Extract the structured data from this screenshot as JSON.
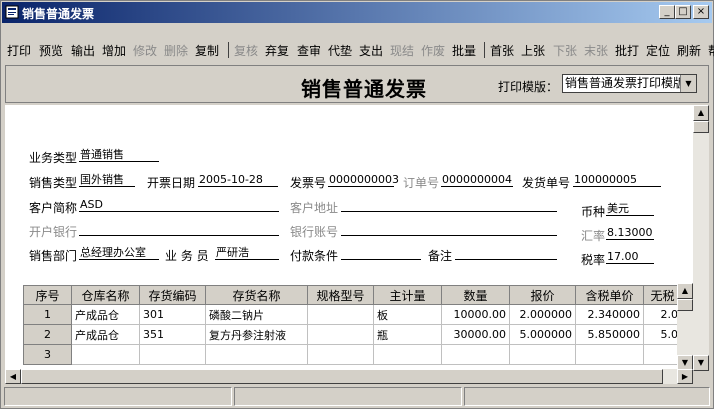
{
  "window": {
    "title": "销售普通发票",
    "controls": [
      "_",
      "□",
      "×"
    ]
  },
  "toolbar": [
    {
      "label": "打印",
      "enabled": true
    },
    {
      "label": "预览",
      "enabled": true
    },
    {
      "label": "输出",
      "enabled": true
    },
    {
      "label": "增加",
      "enabled": true
    },
    {
      "label": "修改",
      "enabled": false
    },
    {
      "label": "删除",
      "enabled": false
    },
    {
      "label": "复制",
      "enabled": true
    },
    {
      "label": "复核",
      "enabled": false
    },
    {
      "label": "弃复",
      "enabled": true
    },
    {
      "label": "查审",
      "enabled": true
    },
    {
      "label": "代垫",
      "enabled": true
    },
    {
      "label": "支出",
      "enabled": true
    },
    {
      "label": "现结",
      "enabled": false
    },
    {
      "label": "作废",
      "enabled": false
    },
    {
      "label": "批量",
      "enabled": true
    },
    {
      "label": "首张",
      "enabled": true
    },
    {
      "label": "上张",
      "enabled": true
    },
    {
      "label": "下张",
      "enabled": false
    },
    {
      "label": "末张",
      "enabled": false
    },
    {
      "label": "批打",
      "enabled": true
    },
    {
      "label": "定位",
      "enabled": true
    },
    {
      "label": "刷新",
      "enabled": true
    },
    {
      "label": "帮",
      "enabled": true
    }
  ],
  "header": {
    "title": "销售普通发票",
    "print_template_label": "打印模版：",
    "print_template_value": "销售普通发票打印模版"
  },
  "form": {
    "business_type": {
      "label": "业务类型",
      "value": "普通销售"
    },
    "sales_type": {
      "label": "销售类型",
      "value": "国外销售"
    },
    "invoice_date": {
      "label": "开票日期",
      "value": "2005-10-28"
    },
    "invoice_no": {
      "label": "发票号",
      "value": "0000000003"
    },
    "order_no": {
      "label": "订单号",
      "value": "0000000004"
    },
    "delivery_no": {
      "label": "发货单号",
      "value": "100000005"
    },
    "customer": {
      "label": "客户简称",
      "value": "ASD"
    },
    "customer_address": {
      "label": "客户地址",
      "value": ""
    },
    "currency": {
      "label": "币种",
      "value": "美元"
    },
    "bank": {
      "label": "开户银行",
      "value": ""
    },
    "bank_account": {
      "label": "银行账号",
      "value": ""
    },
    "exchange_rate": {
      "label": "汇率",
      "value": "8.13000"
    },
    "department": {
      "label": "销售部门",
      "value": "总经理办公室"
    },
    "salesperson": {
      "label": "业 务 员",
      "value": "严研浩"
    },
    "payment_terms": {
      "label": "付款条件",
      "value": ""
    },
    "remark": {
      "label": "备注",
      "value": ""
    },
    "tax_rate": {
      "label": "税率",
      "value": "17.00"
    }
  },
  "table": {
    "columns": [
      "序号",
      "仓库名称",
      "存货编码",
      "存货名称",
      "规格型号",
      "主计量",
      "数量",
      "报价",
      "含税单价",
      "无税"
    ],
    "rows": [
      [
        "1",
        "产成品仓",
        "301",
        "磷酸二钠片",
        "",
        "板",
        "10000.00",
        "2.000000",
        "2.340000",
        "2.0"
      ],
      [
        "2",
        "产成品仓",
        "351",
        "复方丹参注射液",
        "",
        "瓶",
        "30000.00",
        "5.000000",
        "5.850000",
        "5.0"
      ],
      [
        "3",
        "",
        "",
        "",
        "",
        "",
        "",
        "",
        "",
        ""
      ]
    ]
  },
  "colors": {
    "titlebar_start": "#0a246a",
    "titlebar_end": "#a6caf0",
    "face": "#d4d0c8"
  }
}
